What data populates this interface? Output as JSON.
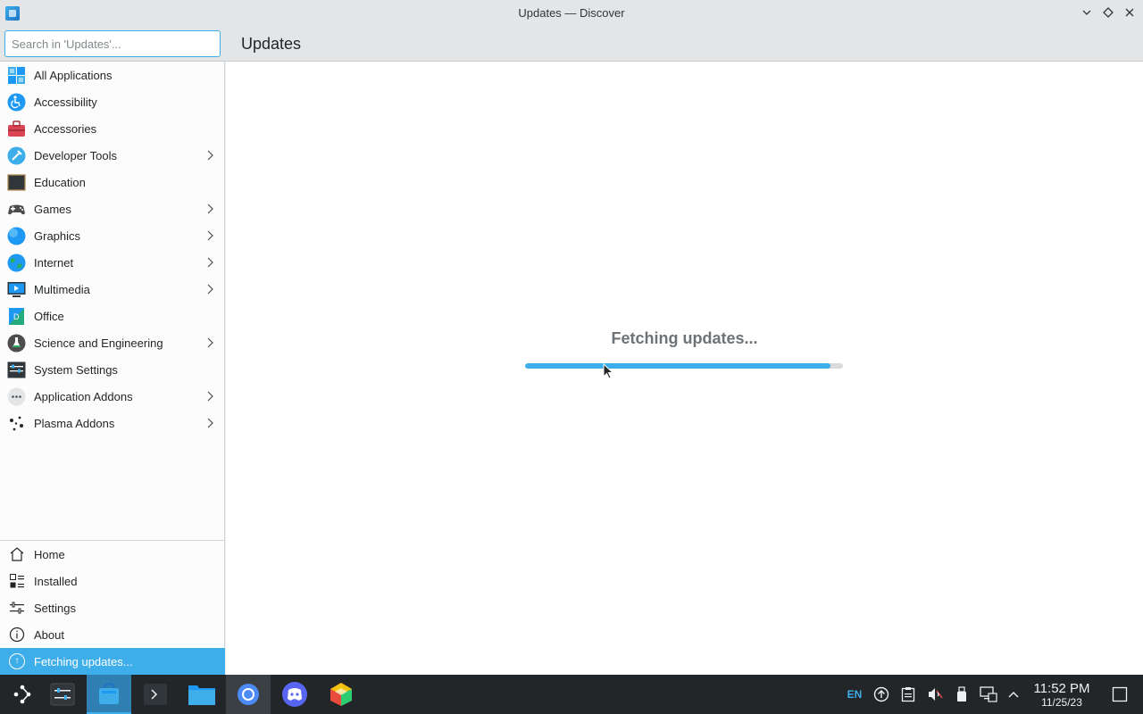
{
  "window": {
    "title": "Updates — Discover",
    "controls": [
      "minimize",
      "maximize",
      "close"
    ]
  },
  "search": {
    "placeholder": "Search in 'Updates'...",
    "value": ""
  },
  "page": {
    "title": "Updates"
  },
  "sidebar": {
    "categories": [
      {
        "label": "All Applications",
        "icon": "grid-icon",
        "has_submenu": false
      },
      {
        "label": "Accessibility",
        "icon": "accessibility-icon",
        "has_submenu": false
      },
      {
        "label": "Accessories",
        "icon": "toolbox-icon",
        "has_submenu": false
      },
      {
        "label": "Developer Tools",
        "icon": "developer-tools-icon",
        "has_submenu": true
      },
      {
        "label": "Education",
        "icon": "chalkboard-icon",
        "has_submenu": false
      },
      {
        "label": "Games",
        "icon": "gamepad-icon",
        "has_submenu": true
      },
      {
        "label": "Graphics",
        "icon": "graphics-icon",
        "has_submenu": true
      },
      {
        "label": "Internet",
        "icon": "globe-icon",
        "has_submenu": true
      },
      {
        "label": "Multimedia",
        "icon": "multimedia-icon",
        "has_submenu": true
      },
      {
        "label": "Office",
        "icon": "office-icon",
        "has_submenu": false
      },
      {
        "label": "Science and Engineering",
        "icon": "flask-icon",
        "has_submenu": true
      },
      {
        "label": "System Settings",
        "icon": "system-settings-icon",
        "has_submenu": false
      },
      {
        "label": "Application Addons",
        "icon": "addons-icon",
        "has_submenu": true
      },
      {
        "label": "Plasma Addons",
        "icon": "plasma-icon",
        "has_submenu": true
      }
    ],
    "nav": [
      {
        "label": "Home",
        "icon": "home-icon"
      },
      {
        "label": "Installed",
        "icon": "installed-icon"
      },
      {
        "label": "Settings",
        "icon": "settings-icon"
      },
      {
        "label": "About",
        "icon": "info-icon"
      }
    ],
    "status": {
      "label": "Fetching updates...",
      "icon": "update-icon"
    }
  },
  "main": {
    "status_text": "Fetching updates...",
    "progress": 0.96
  },
  "taskbar": {
    "language": "EN",
    "time": "11:52 PM",
    "date": "11/25/23",
    "apps": [
      "application-launcher-icon",
      "settings-app-icon",
      "discover-app-icon",
      "terminal-app-icon",
      "file-manager-icon",
      "chromium-icon",
      "discord-icon",
      "game-app-icon"
    ],
    "tray": [
      "update-tray-icon",
      "clipboard-icon",
      "volume-muted-icon",
      "usb-icon",
      "network-icon",
      "expand-tray-icon"
    ]
  },
  "colors": {
    "accent": "#3daee9",
    "taskbar": "#232629",
    "text": "#232629"
  }
}
